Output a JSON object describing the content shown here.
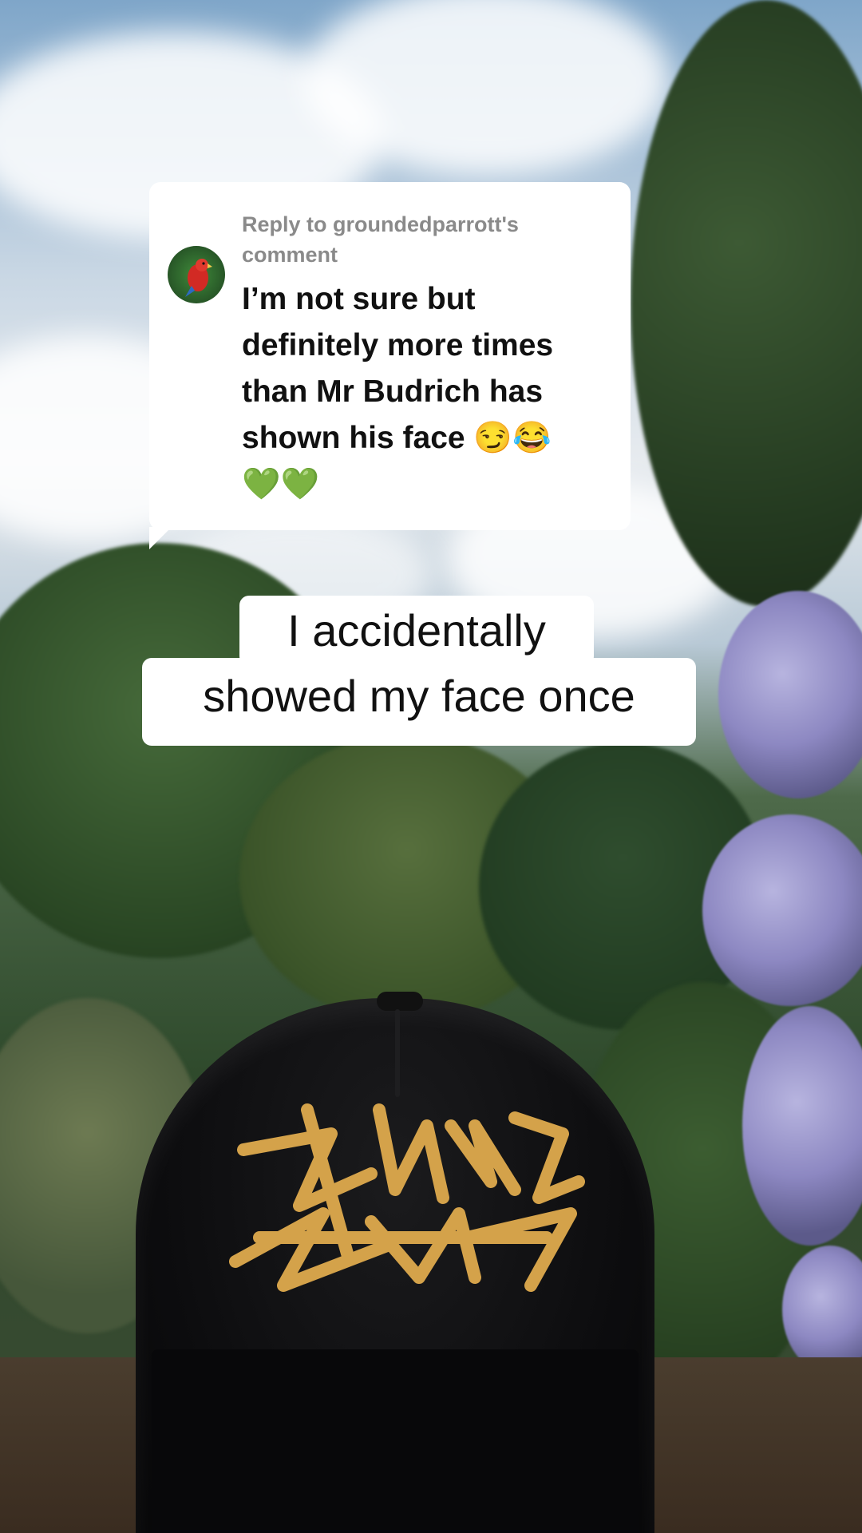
{
  "reply": {
    "header": "Reply to groundedparrott's comment",
    "body": "I’m not sure but definitely more times than Mr Budrich has shown his face 😏😂\n💚💚",
    "avatar_icon": "parrot-avatar-icon"
  },
  "caption": {
    "line1": "I accidentally",
    "line2": "showed my face once"
  },
  "colors": {
    "card_bg": "#ffffff",
    "header_text": "#8a8a8a",
    "body_text": "#111111",
    "embroidery": "#d4a24a"
  }
}
